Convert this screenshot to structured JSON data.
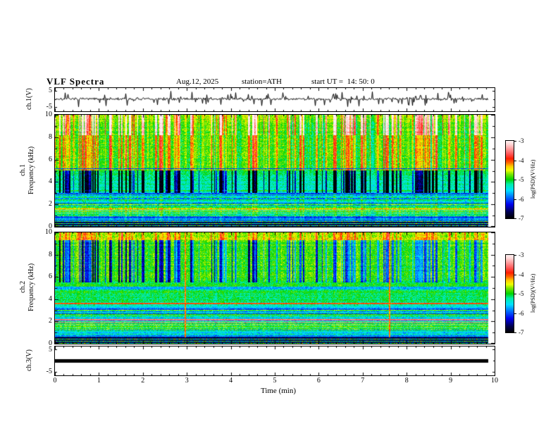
{
  "header": {
    "title": "VLF Spectra",
    "date": "Aug.12, 2025",
    "station": "station=ATH",
    "start_ut": "start UT =  14: 50: 0"
  },
  "xaxis": {
    "label": "Time (min)",
    "ticks": [
      "0",
      "1",
      "2",
      "3",
      "4",
      "5",
      "6",
      "7",
      "8",
      "9",
      "10"
    ]
  },
  "panel_ch1_wave": {
    "ylabel": "ch.1(V)",
    "ytick_top": "5",
    "ytick_bottom": "-5"
  },
  "panel_ch1_spec": {
    "ylabel_channel": "ch.1",
    "ylabel_axis": "Frequency (kHz)",
    "yticks": [
      "10",
      "8",
      "6",
      "4",
      "2",
      "0"
    ]
  },
  "panel_ch2_spec": {
    "ylabel_channel": "ch.2",
    "ylabel_axis": "Frequency (kHz)",
    "yticks": [
      "10",
      "8",
      "6",
      "4",
      "2",
      "0"
    ]
  },
  "panel_ch3_wave": {
    "ylabel": "ch.3(V)",
    "ytick_top": "5",
    "ytick_bottom": "-5"
  },
  "colorbar": {
    "label": "log(PSD)(V²/Hz)",
    "ticks": [
      "-3",
      "-4",
      "-5",
      "-6",
      "-7"
    ],
    "zlim": [
      -7,
      -3
    ],
    "gradient_stops": [
      [
        0.0,
        "#000000"
      ],
      [
        0.08,
        "#00004f"
      ],
      [
        0.18,
        "#0000ee"
      ],
      [
        0.28,
        "#0077ff"
      ],
      [
        0.36,
        "#00e0ff"
      ],
      [
        0.44,
        "#00eeaa"
      ],
      [
        0.5,
        "#00d400"
      ],
      [
        0.57,
        "#7ce600"
      ],
      [
        0.62,
        "#eeff00"
      ],
      [
        0.67,
        "#ffcc00"
      ],
      [
        0.72,
        "#ff6600"
      ],
      [
        0.77,
        "#ff1e00"
      ],
      [
        0.83,
        "#ff5555"
      ],
      [
        0.9,
        "#ff9e9e"
      ],
      [
        0.96,
        "#ffd9d9"
      ],
      [
        1.0,
        "#fff2f2"
      ]
    ]
  },
  "chart_data": [
    {
      "type": "line",
      "panel": "ch.1 waveform",
      "ylabel": "ch.1(V)",
      "ylim": [
        -5,
        5
      ],
      "xlabel": "Time (min)",
      "xlim": [
        0,
        10
      ],
      "data_end_min": 9.85,
      "description": "dense noisy waveform around 0 V with frequent impulsive spikes up to ±4 V",
      "render": {
        "seed": 7,
        "jitter_v": 0.8,
        "spike_prob": 0.13,
        "spike_min_v": 1.2,
        "spike_max_v": 4.3
      }
    },
    {
      "type": "heatmap",
      "panel": "ch.1 spectrogram",
      "ylabel": "Frequency (kHz)",
      "ylim": [
        0,
        10
      ],
      "xlim": [
        0,
        10
      ],
      "data_end_min": 9.85,
      "zlabel": "log(PSD)(V²/Hz)",
      "zlim": [
        -7,
        -3
      ],
      "description": "green background with bright vertical sferic stripes above 5 kHz, red patches near 8-10 kHz, dark blue vertical streaks at 3-5 kHz, cyan horizontal banding at 2-3 kHz, dark rows below 0.5 kHz",
      "render": {
        "seed": 11,
        "profile": [
          [
            10,
            -4.65
          ],
          [
            9,
            -4.8
          ],
          [
            8.3,
            -4.85
          ],
          [
            5.2,
            -4.9
          ],
          [
            4.9,
            -5.15
          ],
          [
            4.0,
            -5.3
          ],
          [
            3.1,
            -5.35
          ],
          [
            2.9,
            -5.6
          ],
          [
            2.3,
            -5.55
          ],
          [
            2.0,
            -5.1
          ],
          [
            1.5,
            -5.05
          ],
          [
            1.1,
            -5.25
          ],
          [
            0.9,
            -5.7
          ],
          [
            0.6,
            -6.0
          ],
          [
            0.5,
            -6.4
          ],
          [
            0,
            -6.9
          ]
        ],
        "dark_lines_khz": [
          5.2,
          2.1,
          0.85
        ],
        "dark_band_khz": [
          0,
          0.5
        ]
      }
    },
    {
      "type": "heatmap",
      "panel": "ch.2 spectrogram",
      "ylabel": "Frequency (kHz)",
      "ylim": [
        0,
        10
      ],
      "xlim": [
        0,
        10
      ],
      "data_end_min": 9.85,
      "zlabel": "log(PSD)(V²/Hz)",
      "zlim": [
        -7,
        -3
      ],
      "description": "green background with dark blue vertical streaks at 5.5-9 kHz, strong red horizontal lines near 3.6 and 2.1 kHz, dark band near 5 kHz, cyan banding below 3 kHz, dark rows below 0.5 kHz, thin orange vertical lines near 2.95 and 7.6 min",
      "render": {
        "seed": 23,
        "profile": [
          [
            10,
            -4.75
          ],
          [
            9.4,
            -4.7
          ],
          [
            9,
            -4.85
          ],
          [
            6,
            -4.9
          ],
          [
            5.3,
            -5.0
          ],
          [
            4.2,
            -5.15
          ],
          [
            3.8,
            -5.2
          ],
          [
            3.3,
            -5.45
          ],
          [
            2.6,
            -5.5
          ],
          [
            2.3,
            -5.3
          ],
          [
            1.8,
            -5.0
          ],
          [
            1.4,
            -5.15
          ],
          [
            1.15,
            -5.45
          ],
          [
            0.8,
            -5.35
          ],
          [
            0.6,
            -6.1
          ],
          [
            0.45,
            -6.5
          ],
          [
            0,
            -6.85
          ]
        ],
        "red_lines_khz": [
          3.62,
          2.14
        ],
        "orange_lines_khz": [
          1.95
        ],
        "gray_band_khz": [
          4.88,
          5.12
        ],
        "dark_band_khz": [
          0,
          0.55
        ],
        "orange_vertical_min": [
          2.95,
          7.6
        ]
      }
    },
    {
      "type": "line",
      "panel": "ch.3 waveform",
      "ylabel": "ch.3(V)",
      "ylim": [
        -5,
        5
      ],
      "xlim": [
        0,
        10
      ],
      "data_end_min": 9.85,
      "description": "flat thick black trace at 0 V (saturated / no signal)",
      "render": {
        "thickness_px": 5,
        "value_v": 0
      }
    }
  ]
}
